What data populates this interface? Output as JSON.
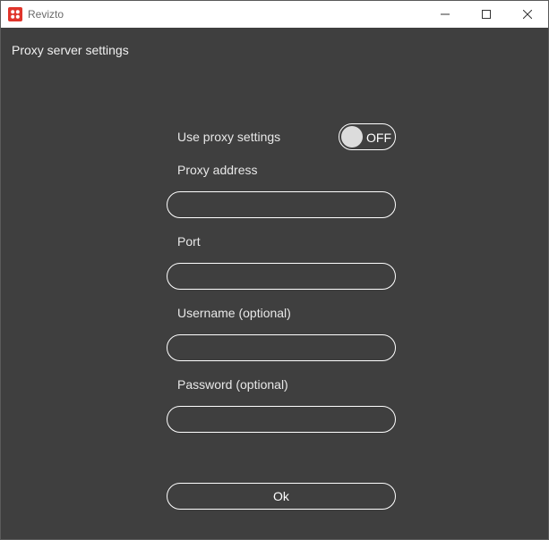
{
  "window": {
    "title": "Revizto",
    "app_icon": "revizto-logo-icon",
    "controls": [
      "minimize-icon",
      "maximize-icon",
      "close-icon"
    ]
  },
  "page": {
    "title": "Proxy server settings"
  },
  "form": {
    "use_proxy": {
      "label": "Use proxy settings",
      "state": "OFF"
    },
    "proxy_address": {
      "label": "Proxy address",
      "value": ""
    },
    "port": {
      "label": "Port",
      "value": ""
    },
    "username": {
      "label": "Username (optional)",
      "value": ""
    },
    "password": {
      "label": "Password (optional)",
      "value": ""
    },
    "ok_label": "Ok"
  },
  "colors": {
    "background": "#3f3f3f",
    "titlebar": "#ffffff",
    "accent": "#e0352b",
    "border": "#ffffff"
  }
}
